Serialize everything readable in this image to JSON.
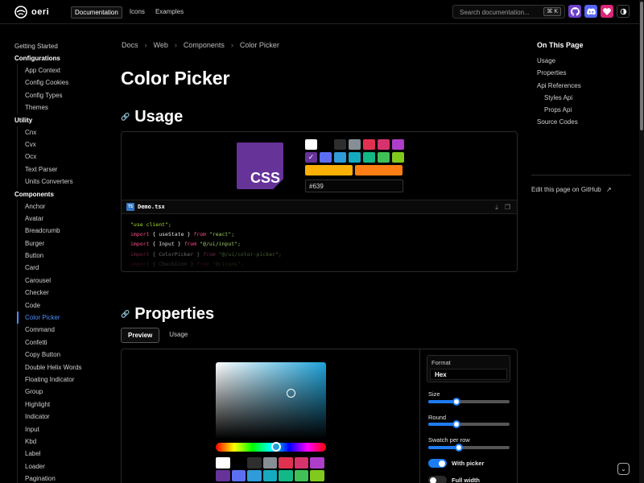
{
  "header": {
    "logo_text": "oeri",
    "nav": [
      "Documentation",
      "Icons",
      "Examples"
    ],
    "search_placeholder": "Search documentation...",
    "search_kbd": "⌘ K",
    "icons": [
      {
        "name": "github-icon",
        "color": "#6e40c9"
      },
      {
        "name": "discord-icon",
        "color": "#5865f2"
      },
      {
        "name": "sponsor-heart-icon",
        "color": "#db2777"
      },
      {
        "name": "theme-toggle-icon",
        "color": "#000000"
      }
    ]
  },
  "sidebar": {
    "getting_started": "Getting Started",
    "sections": [
      {
        "title": "Configurations",
        "items": [
          "App Context",
          "Config Cookies",
          "Config Types",
          "Themes"
        ]
      },
      {
        "title": "Utility",
        "items": [
          "Cnx",
          "Cvx",
          "Ocx",
          "Text Parser",
          "Units Converters"
        ]
      },
      {
        "title": "Components",
        "items": [
          "Anchor",
          "Avatar",
          "Breadcrumb",
          "Burger",
          "Button",
          "Card",
          "Carousel",
          "Checker",
          "Code",
          "Color Picker",
          "Command",
          "Confetti",
          "Copy Button",
          "Double Helix Words",
          "Floating Indicator",
          "Group",
          "Highlight",
          "Indicator",
          "Input",
          "Kbd",
          "Label",
          "Loader",
          "Pagination"
        ]
      }
    ],
    "active": "Color Picker"
  },
  "breadcrumb": [
    "Docs",
    "Web",
    "Components",
    "Color Picker"
  ],
  "page_title": "Color Picker",
  "usage": {
    "title": "Usage",
    "logo_text": "CSS",
    "swatches": [
      "#ffffff",
      "#000000",
      "#2e2e2e",
      "#868e96",
      "#e03150",
      "#d6336c",
      "#ae3ec9",
      "#663399",
      "#5c6ff2",
      "#2f9bd8",
      "#15aabf",
      "#12b886",
      "#40c057",
      "#82c91e"
    ],
    "selected_swatch_index": 7,
    "wide_swatches": [
      "#fab005",
      "#fd7e14"
    ],
    "hex_value": "#639",
    "file_name": "Demo.tsx",
    "ts_badge": "TS",
    "code_lines": [
      [
        {
          "t": "\"use client\";",
          "c": "str"
        }
      ],
      [
        {
          "t": "import",
          "c": "kw"
        },
        {
          "t": " { ",
          "c": "pl"
        },
        {
          "t": "useState",
          "c": "pl"
        },
        {
          "t": " } ",
          "c": "pl"
        },
        {
          "t": "from",
          "c": "fr"
        },
        {
          "t": " \"react\";",
          "c": "sv"
        }
      ],
      [
        {
          "t": "import",
          "c": "kw"
        },
        {
          "t": " { ",
          "c": "pl"
        },
        {
          "t": "Input",
          "c": "pl"
        },
        {
          "t": " } ",
          "c": "pl"
        },
        {
          "t": "from",
          "c": "fr"
        },
        {
          "t": " \"@/ui/input\";",
          "c": "sv"
        }
      ],
      [
        {
          "t": "import",
          "c": "kw"
        },
        {
          "t": " { ",
          "c": "pl"
        },
        {
          "t": "ColorPicker",
          "c": "pl"
        },
        {
          "t": " } ",
          "c": "pl"
        },
        {
          "t": "from",
          "c": "fr"
        },
        {
          "t": " \"@/ui/color-picker\";",
          "c": "sv"
        }
      ],
      [
        {
          "t": "import",
          "c": "kw"
        },
        {
          "t": " { ",
          "c": "pl"
        },
        {
          "t": "CheckIcon",
          "c": "pl"
        },
        {
          "t": " } ",
          "c": "pl"
        },
        {
          "t": "from",
          "c": "fr"
        },
        {
          "t": " \"@/icons\";",
          "c": "sv"
        }
      ]
    ]
  },
  "properties": {
    "title": "Properties",
    "tabs": [
      "Preview",
      "Usage"
    ],
    "active_tab": "Preview",
    "hue_color": "#1ea3d9",
    "swatches": [
      "#ffffff",
      "#000000",
      "#2e2e2e",
      "#868e96",
      "#e03150",
      "#d6336c",
      "#ae3ec9",
      "#663399",
      "#5c6ff2",
      "#2f9bd8",
      "#15aabf",
      "#12b886",
      "#40c057",
      "#82c91e"
    ],
    "controls": {
      "format_label": "Format",
      "format_value": "Hex",
      "size_label": "Size",
      "size_value": 0.35,
      "round_label": "Round",
      "round_value": 0.35,
      "swatch_per_row_label": "Swatch per row",
      "swatch_per_row_value": 0.38,
      "with_picker_label": "With picker",
      "with_picker_on": true,
      "full_width_label": "Full width",
      "full_width_on": false
    }
  },
  "toc": {
    "title": "On This Page",
    "items": [
      {
        "label": "Usage",
        "sub": false
      },
      {
        "label": "Properties",
        "sub": false
      },
      {
        "label": "Api References",
        "sub": false
      },
      {
        "label": "Styles Api",
        "sub": true
      },
      {
        "label": "Props Api",
        "sub": true
      },
      {
        "label": "Source Codes",
        "sub": false
      }
    ],
    "edit_link": "Edit this page on GitHub",
    "edit_arrow": "↗"
  }
}
